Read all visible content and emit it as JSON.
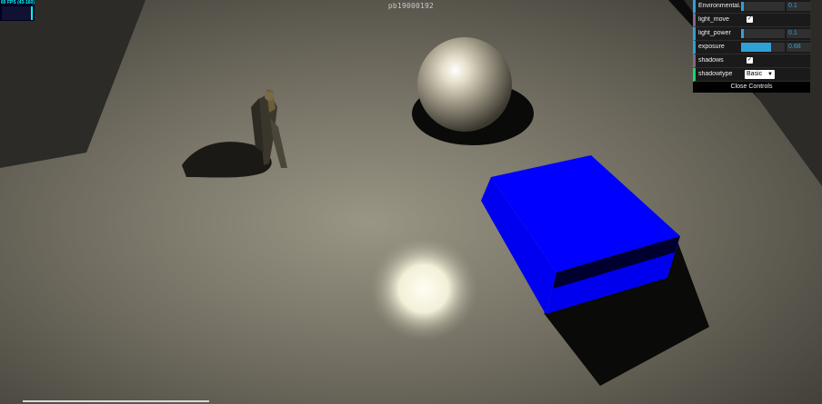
{
  "title": "pb19000192",
  "stats": {
    "fps_text": "60 FPS (43-160)",
    "fps_value": 60
  },
  "gui": {
    "controls": [
      {
        "label": "Environmental...",
        "type": "slider",
        "value": "0.1",
        "fraction": 0.07
      },
      {
        "label": "light_move",
        "type": "checkbox",
        "checked": true
      },
      {
        "label": "light_power",
        "type": "slider",
        "value": "0.1",
        "fraction": 0.07
      },
      {
        "label": "exposure",
        "type": "slider",
        "value": "0.68",
        "fraction": 0.68
      },
      {
        "label": "shadows",
        "type": "checkbox",
        "checked": true
      },
      {
        "label": "shadowtype",
        "type": "select",
        "value": "Basic"
      }
    ],
    "close_label": "Close Controls"
  },
  "colors": {
    "cube": "#0000ff",
    "floor": "#8a8577",
    "accent": "#2fa1d6",
    "stats": "#00ffff"
  },
  "icons": {
    "checkbox": "check-icon",
    "select": "chevron-down-icon"
  }
}
